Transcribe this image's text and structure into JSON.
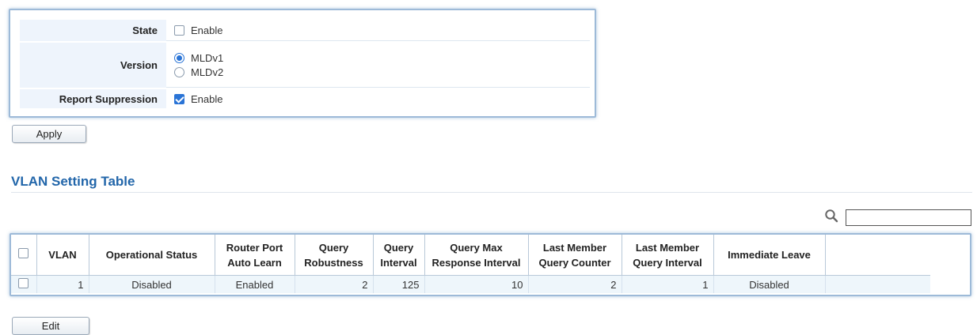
{
  "settings": {
    "state": {
      "label": "State",
      "option": "Enable",
      "checked": false
    },
    "version": {
      "label": "Version",
      "options": [
        "MLDv1",
        "MLDv2"
      ],
      "selected": "MLDv1"
    },
    "report_suppression": {
      "label": "Report Suppression",
      "option": "Enable",
      "checked": true
    }
  },
  "apply_label": "Apply",
  "vlan_table": {
    "title": "VLAN Setting Table",
    "search_value": "",
    "columns": [
      "VLAN",
      "Operational Status",
      "Router Port Auto Learn",
      "Query Robustness",
      "Query Interval",
      "Query Max Response Interval",
      "Last Member Query Counter",
      "Last Member Query Interval",
      "Immediate Leave"
    ],
    "header_lines": {
      "vlan": [
        "VLAN"
      ],
      "operational_status": [
        "Operational Status"
      ],
      "router_port_auto_learn": [
        "Router Port",
        "Auto Learn"
      ],
      "query_robustness": [
        "Query",
        "Robustness"
      ],
      "query_interval": [
        "Query",
        "Interval"
      ],
      "query_max_response_interval": [
        "Query Max",
        "Response Interval"
      ],
      "last_member_query_counter": [
        "Last Member",
        "Query Counter"
      ],
      "last_member_query_interval": [
        "Last Member",
        "Query Interval"
      ],
      "immediate_leave": [
        "Immediate Leave"
      ]
    },
    "rows": [
      {
        "selected": false,
        "vlan": "1",
        "operational_status": "Disabled",
        "router_port_auto_learn": "Enabled",
        "query_robustness": "2",
        "query_interval": "125",
        "query_max_response_interval": "10",
        "last_member_query_counter": "2",
        "last_member_query_interval": "1",
        "immediate_leave": "Disabled"
      }
    ]
  },
  "edit_label": "Edit",
  "colors": {
    "accent": "#2a74d6",
    "title": "#2266aa",
    "panel_border": "#9dbad8",
    "row_bg": "#eef6fb"
  }
}
